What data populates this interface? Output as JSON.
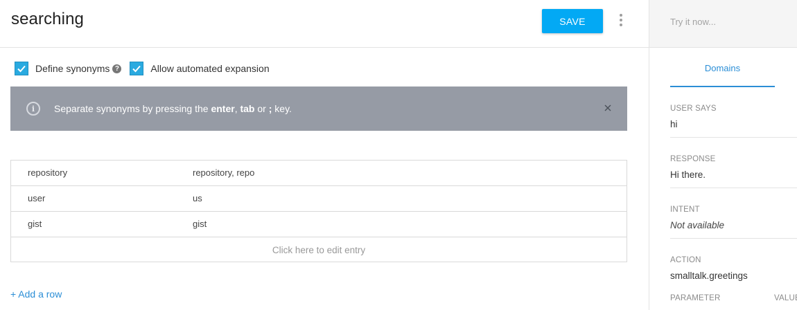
{
  "header": {
    "title": "searching",
    "save_label": "SAVE"
  },
  "options": {
    "define_synonyms_label": "Define synonyms",
    "define_synonyms_checked": true,
    "help_glyph": "?",
    "allow_expansion_label": "Allow automated expansion",
    "allow_expansion_checked": true
  },
  "banner": {
    "info_glyph": "i",
    "text_prefix": "Separate synonyms by pressing the ",
    "key_enter": "enter",
    "text_sep": ", ",
    "key_tab": "tab",
    "text_or": " or ",
    "key_semicolon": ";",
    "text_suffix": " key."
  },
  "table": {
    "rows": [
      {
        "value": "repository",
        "synonyms": "repository, repo"
      },
      {
        "value": "user",
        "synonyms": "us"
      },
      {
        "value": "gist",
        "synonyms": "gist"
      }
    ],
    "edit_placeholder": "Click here to edit entry"
  },
  "add_row_label": "+ Add a row",
  "sidebar": {
    "try_placeholder": "Try it now...",
    "tab_label": "Domains",
    "user_says_label": "USER SAYS",
    "user_says_value": "hi",
    "response_label": "RESPONSE",
    "response_value": "Hi there.",
    "intent_label": "INTENT",
    "intent_value": "Not available",
    "action_label": "ACTION",
    "action_value": "smalltalk.greetings",
    "parameter_label": "PARAMETER",
    "value_label": "VALUE"
  },
  "icons": {
    "kebab": "more-vert-icon",
    "checkbox": "check-icon",
    "help": "help-icon",
    "info": "info-icon",
    "close": "close-icon"
  },
  "colors": {
    "accent": "#03a9f4",
    "checkbox": "#2aaae0",
    "banner": "#969ba5",
    "link": "#2b8ed6"
  }
}
